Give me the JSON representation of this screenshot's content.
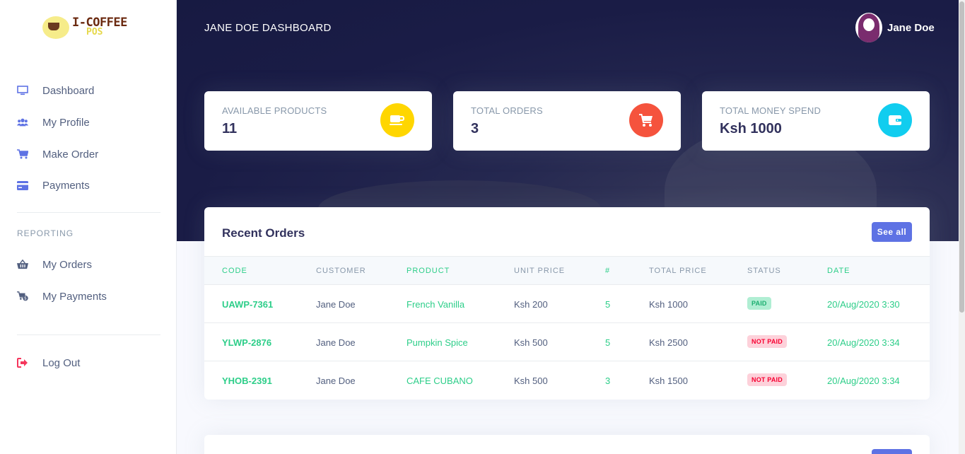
{
  "app": {
    "logo_main": "I-COFFEE",
    "logo_sub": "POS"
  },
  "sidebar": {
    "items": [
      {
        "label": "Dashboard",
        "icon": "monitor-icon",
        "color": "#5e72e4"
      },
      {
        "label": "My Profile",
        "icon": "users-icon",
        "color": "#5e72e4"
      },
      {
        "label": "Make Order",
        "icon": "cart-icon",
        "color": "#5e72e4"
      },
      {
        "label": "Payments",
        "icon": "credit-card-icon",
        "color": "#5e72e4"
      }
    ],
    "section_label": "REPORTING",
    "report_items": [
      {
        "label": "My Orders",
        "icon": "basket-icon",
        "color": "#525f7f"
      },
      {
        "label": "My Payments",
        "icon": "cart-dollar-icon",
        "color": "#525f7f"
      }
    ],
    "logout_label": "Log Out",
    "logout_icon": "sign-out-icon",
    "logout_color": "#f5365c"
  },
  "header": {
    "title": "JANE DOE DASHBOARD",
    "user_name": "Jane Doe"
  },
  "stats": [
    {
      "title": "AVAILABLE PRODUCTS",
      "value": "11",
      "icon": "mug-icon",
      "color": "#ffd600"
    },
    {
      "title": "TOTAL ORDERS",
      "value": "3",
      "icon": "cart-icon",
      "color": "#f5365c"
    },
    {
      "title": "TOTAL MONEY SPEND",
      "value": "Ksh 1000",
      "icon": "wallet-icon",
      "color": "#11cdef"
    }
  ],
  "orders": {
    "title": "Recent Orders",
    "see_all_label": "See all",
    "columns": [
      "CODE",
      "CUSTOMER",
      "PRODUCT",
      "UNIT PRICE",
      "#",
      "TOTAL PRICE",
      "STATUS",
      "DATE"
    ],
    "rows": [
      {
        "code": "UAWP-7361",
        "customer": "Jane Doe",
        "product": "French Vanilla",
        "unit_price": "Ksh 200",
        "qty": "5",
        "total": "Ksh 1000",
        "status": "PAID",
        "date": "20/Aug/2020 3:30"
      },
      {
        "code": "YLWP-2876",
        "customer": "Jane Doe",
        "product": "Pumpkin Spice",
        "unit_price": "Ksh 500",
        "qty": "5",
        "total": "Ksh 2500",
        "status": "NOT PAID",
        "date": "20/Aug/2020 3:34"
      },
      {
        "code": "YHOB-2391",
        "customer": "Jane Doe",
        "product": "CAFE CUBANO",
        "unit_price": "Ksh 500",
        "qty": "3",
        "total": "Ksh 1500",
        "status": "NOT PAID",
        "date": "20/Aug/2020 3:34"
      }
    ]
  },
  "colors": {
    "accent": "#5e72e4",
    "green": "#2dce89",
    "header_bg": "#1a1c46"
  }
}
